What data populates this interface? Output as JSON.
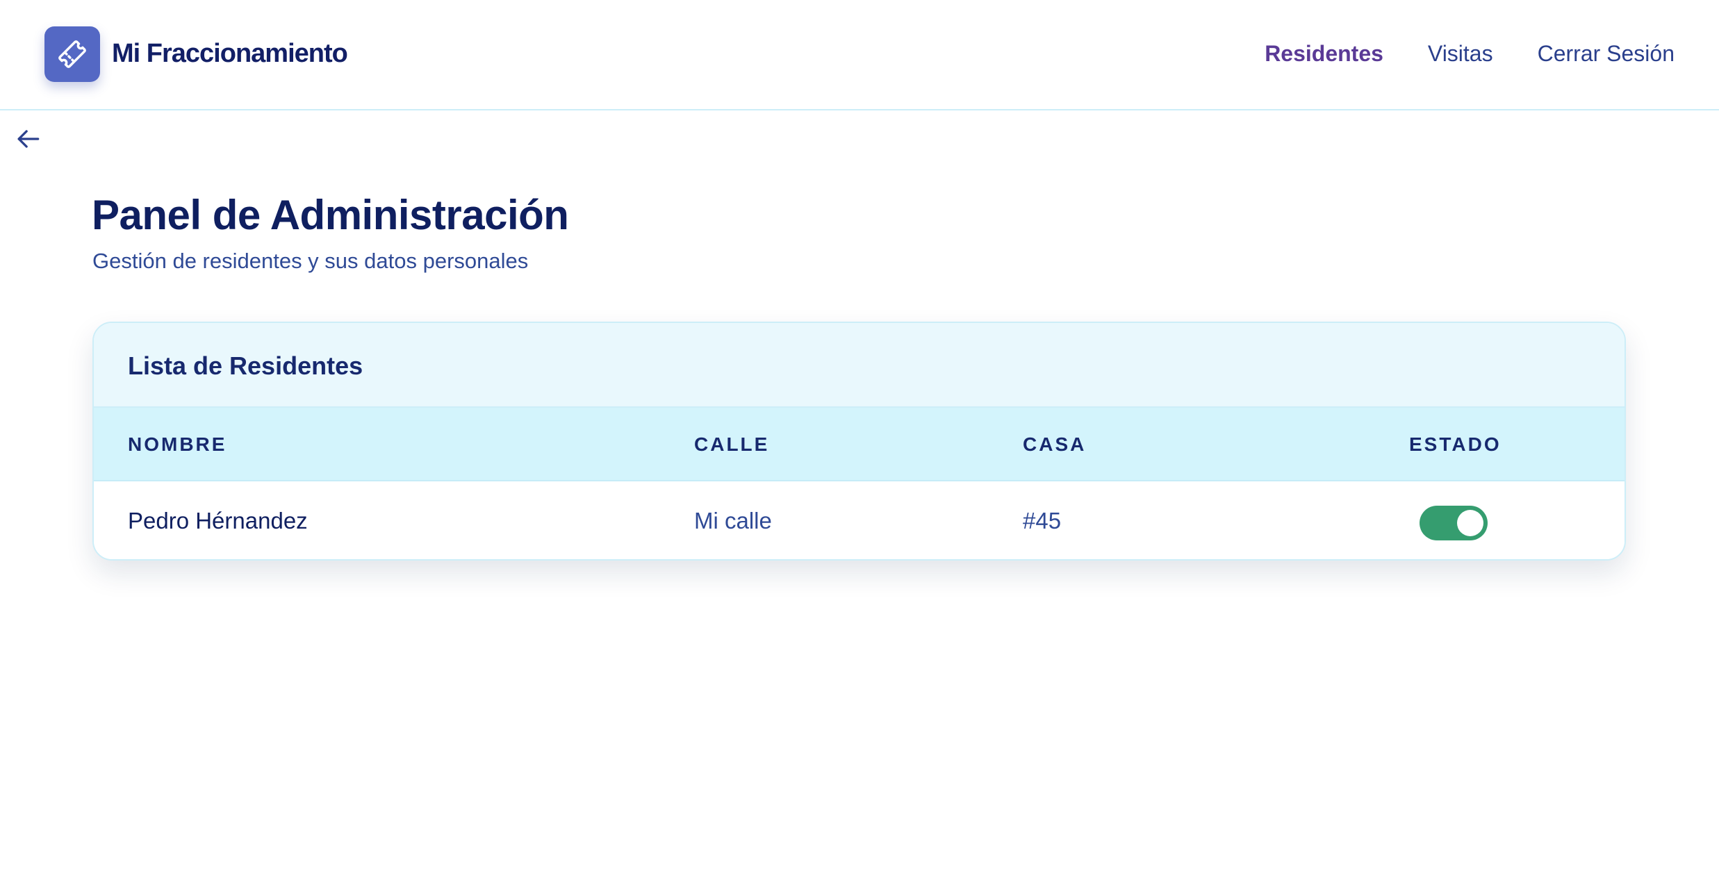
{
  "header": {
    "brand": "Mi Fraccionamiento",
    "logo_icon": "ticket-icon",
    "nav": [
      {
        "label": "Residentes",
        "active": true
      },
      {
        "label": "Visitas",
        "active": false
      },
      {
        "label": "Cerrar Sesión",
        "active": false
      }
    ]
  },
  "back_icon": "arrow-left-icon",
  "page": {
    "title": "Panel de Administración",
    "subtitle": "Gestión de residentes y sus datos personales"
  },
  "residents_card": {
    "title": "Lista de Residentes",
    "columns": [
      "NOMBRE",
      "CALLE",
      "CASA",
      "ESTADO"
    ],
    "rows": [
      {
        "nombre": "Pedro Hérnandez",
        "calle": "Mi calle",
        "casa": "#45",
        "estado_active": true
      }
    ]
  },
  "colors": {
    "primary_dark": "#0f1f60",
    "nav_active": "#5a3a96",
    "logo_bg": "#5468c4",
    "card_head_bg": "#e9f8fd",
    "table_head_bg": "#d3f4fc",
    "toggle_on": "#359d6f"
  }
}
